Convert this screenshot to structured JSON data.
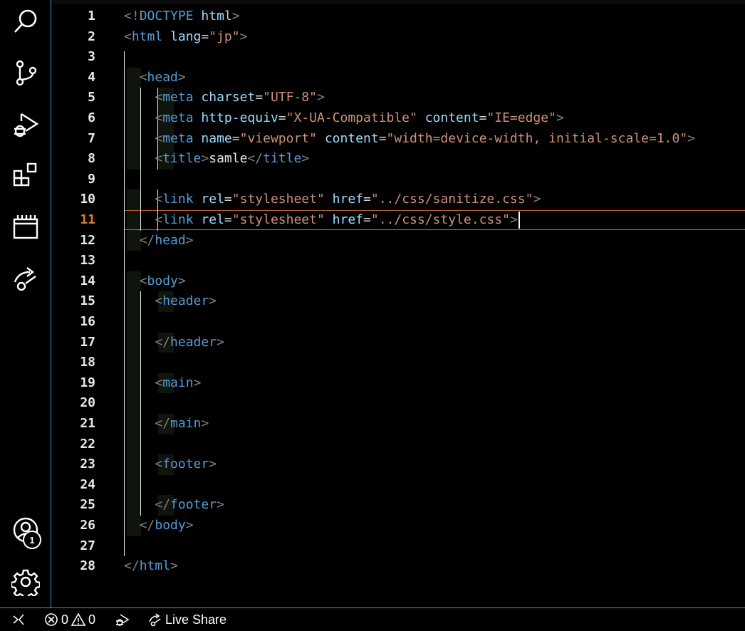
{
  "activity_bar": {
    "icons": [
      "search-icon",
      "source-control-icon",
      "run-debug-icon",
      "extensions-icon",
      "remote-explorer-icon",
      "live-share-icon",
      "account-icon",
      "settings-gear-icon"
    ],
    "account_badge": "1"
  },
  "editor": {
    "active_line": 11,
    "lines": [
      {
        "n": "1",
        "tokens": [
          [
            "br",
            "<!"
          ],
          [
            "tag",
            "DOCTYPE"
          ],
          [
            "txt",
            " "
          ],
          [
            "attr",
            "html"
          ],
          [
            "br",
            ">"
          ]
        ]
      },
      {
        "n": "2",
        "tokens": [
          [
            "br",
            "<"
          ],
          [
            "tag",
            "html"
          ],
          [
            "txt",
            " "
          ],
          [
            "attr",
            "lang"
          ],
          [
            "eq",
            "="
          ],
          [
            "str",
            "\"jp\""
          ],
          [
            "br",
            ">"
          ]
        ]
      },
      {
        "n": "3",
        "tokens": []
      },
      {
        "n": "4",
        "tokens": [
          [
            "txt",
            "  "
          ],
          [
            "br",
            "<"
          ],
          [
            "tag",
            "head"
          ],
          [
            "br",
            ">"
          ]
        ]
      },
      {
        "n": "5",
        "tokens": [
          [
            "txt",
            "    "
          ],
          [
            "br",
            "<"
          ],
          [
            "tag",
            "meta"
          ],
          [
            "txt",
            " "
          ],
          [
            "attr",
            "charset"
          ],
          [
            "eq",
            "="
          ],
          [
            "str",
            "\"UTF-8\""
          ],
          [
            "br",
            ">"
          ]
        ]
      },
      {
        "n": "6",
        "tokens": [
          [
            "txt",
            "    "
          ],
          [
            "br",
            "<"
          ],
          [
            "tag",
            "meta"
          ],
          [
            "txt",
            " "
          ],
          [
            "attr",
            "http-equiv"
          ],
          [
            "eq",
            "="
          ],
          [
            "str",
            "\"X-UA-Compatible\""
          ],
          [
            "txt",
            " "
          ],
          [
            "attr",
            "content"
          ],
          [
            "eq",
            "="
          ],
          [
            "str",
            "\"IE=edge\""
          ],
          [
            "br",
            ">"
          ]
        ]
      },
      {
        "n": "7",
        "tokens": [
          [
            "txt",
            "    "
          ],
          [
            "br",
            "<"
          ],
          [
            "tag",
            "meta"
          ],
          [
            "txt",
            " "
          ],
          [
            "attr",
            "name"
          ],
          [
            "eq",
            "="
          ],
          [
            "str",
            "\"viewport\""
          ],
          [
            "txt",
            " "
          ],
          [
            "attr",
            "content"
          ],
          [
            "eq",
            "="
          ],
          [
            "str",
            "\"width=device-width, initial-scale=1.0\""
          ],
          [
            "br",
            ">"
          ]
        ]
      },
      {
        "n": "8",
        "tokens": [
          [
            "txt",
            "    "
          ],
          [
            "br",
            "<"
          ],
          [
            "tag",
            "title"
          ],
          [
            "br",
            ">"
          ],
          [
            "txt",
            "samle"
          ],
          [
            "br",
            "</"
          ],
          [
            "tag",
            "title"
          ],
          [
            "br",
            ">"
          ]
        ]
      },
      {
        "n": "9",
        "tokens": []
      },
      {
        "n": "10",
        "tokens": [
          [
            "txt",
            "    "
          ],
          [
            "br",
            "<"
          ],
          [
            "tag",
            "link"
          ],
          [
            "txt",
            " "
          ],
          [
            "attr",
            "rel"
          ],
          [
            "eq",
            "="
          ],
          [
            "str",
            "\"stylesheet\""
          ],
          [
            "txt",
            " "
          ],
          [
            "attr",
            "href"
          ],
          [
            "eq",
            "="
          ],
          [
            "str",
            "\"../css/sanitize.css\""
          ],
          [
            "br",
            ">"
          ]
        ]
      },
      {
        "n": "11",
        "tokens": [
          [
            "txt",
            "    "
          ],
          [
            "br",
            "<"
          ],
          [
            "tag",
            "link"
          ],
          [
            "txt",
            " "
          ],
          [
            "attr",
            "rel"
          ],
          [
            "eq",
            "="
          ],
          [
            "str",
            "\"stylesheet\""
          ],
          [
            "txt",
            " "
          ],
          [
            "attr",
            "href"
          ],
          [
            "eq",
            "="
          ],
          [
            "str",
            "\"../css/style.css\""
          ],
          [
            "br",
            ">"
          ]
        ]
      },
      {
        "n": "12",
        "tokens": [
          [
            "txt",
            "  "
          ],
          [
            "br",
            "</"
          ],
          [
            "tag",
            "head"
          ],
          [
            "br",
            ">"
          ]
        ]
      },
      {
        "n": "13",
        "tokens": []
      },
      {
        "n": "14",
        "tokens": [
          [
            "txt",
            "  "
          ],
          [
            "br",
            "<"
          ],
          [
            "tag",
            "body"
          ],
          [
            "br",
            ">"
          ]
        ]
      },
      {
        "n": "15",
        "tokens": [
          [
            "txt",
            "    "
          ],
          [
            "br",
            "<"
          ],
          [
            "tag",
            "header"
          ],
          [
            "br",
            ">"
          ]
        ]
      },
      {
        "n": "16",
        "tokens": []
      },
      {
        "n": "17",
        "tokens": [
          [
            "txt",
            "    "
          ],
          [
            "br",
            "</"
          ],
          [
            "tag",
            "header"
          ],
          [
            "br",
            ">"
          ]
        ]
      },
      {
        "n": "18",
        "tokens": []
      },
      {
        "n": "19",
        "tokens": [
          [
            "txt",
            "    "
          ],
          [
            "br",
            "<"
          ],
          [
            "tag",
            "main"
          ],
          [
            "br",
            ">"
          ]
        ]
      },
      {
        "n": "20",
        "tokens": []
      },
      {
        "n": "21",
        "tokens": [
          [
            "txt",
            "    "
          ],
          [
            "br",
            "</"
          ],
          [
            "tag",
            "main"
          ],
          [
            "br",
            ">"
          ]
        ]
      },
      {
        "n": "22",
        "tokens": []
      },
      {
        "n": "23",
        "tokens": [
          [
            "txt",
            "    "
          ],
          [
            "br",
            "<"
          ],
          [
            "tag",
            "footer"
          ],
          [
            "br",
            ">"
          ]
        ]
      },
      {
        "n": "24",
        "tokens": []
      },
      {
        "n": "25",
        "tokens": [
          [
            "txt",
            "    "
          ],
          [
            "br",
            "</"
          ],
          [
            "tag",
            "footer"
          ],
          [
            "br",
            ">"
          ]
        ]
      },
      {
        "n": "26",
        "tokens": [
          [
            "txt",
            "  "
          ],
          [
            "br",
            "</"
          ],
          [
            "tag",
            "body"
          ],
          [
            "br",
            ">"
          ]
        ]
      },
      {
        "n": "27",
        "tokens": []
      },
      {
        "n": "28",
        "tokens": [
          [
            "br",
            "</"
          ],
          [
            "tag",
            "html"
          ],
          [
            "br",
            ">"
          ]
        ]
      }
    ]
  },
  "status_bar": {
    "errors": "0",
    "warnings": "0",
    "live_share_label": "Live Share"
  },
  "colors": {
    "accent_border": "#4a8fc4",
    "active_line_number": "#e07b2e",
    "tag": "#569cd6",
    "attribute": "#9cdcfe",
    "string": "#ce9178"
  }
}
